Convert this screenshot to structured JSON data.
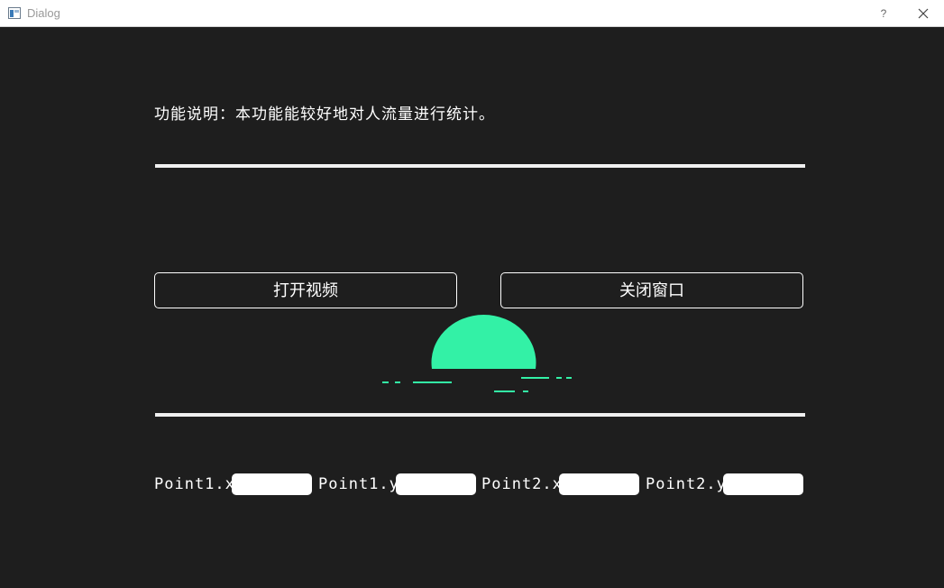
{
  "window": {
    "title": "Dialog",
    "help": "?",
    "colors": {
      "background": "#1e1e1e",
      "accent": "#33f1a6"
    }
  },
  "description": "功能说明：本功能能较好地对人流量进行统计。",
  "buttons": {
    "open_video": "打开视频",
    "close_window": "关闭窗口"
  },
  "points": [
    {
      "label": "Point1.x",
      "value": ""
    },
    {
      "label": "Point1.y",
      "value": ""
    },
    {
      "label": "Point2.x",
      "value": ""
    },
    {
      "label": "Point2.y",
      "value": ""
    }
  ]
}
